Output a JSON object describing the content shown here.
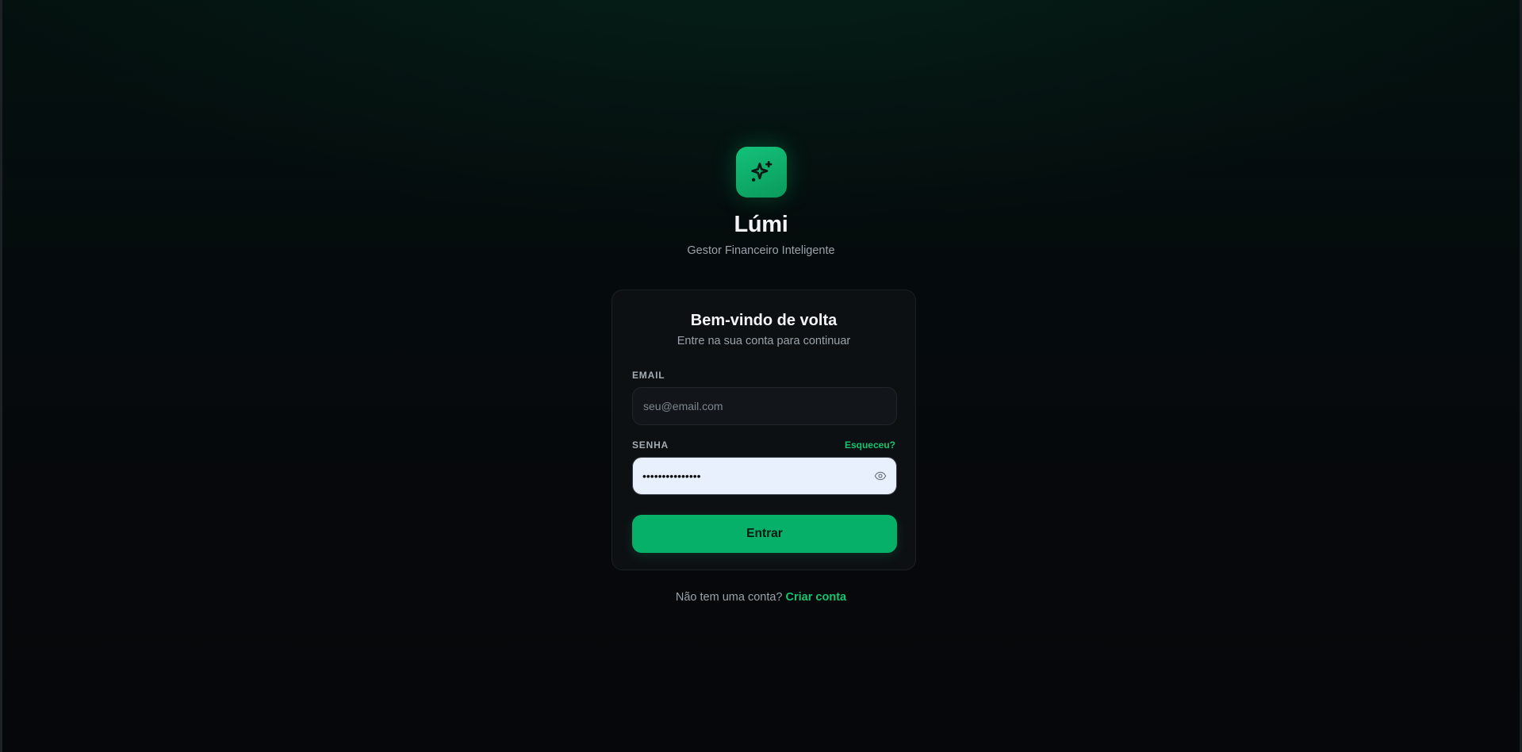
{
  "brand": {
    "icon": "sparkles-icon",
    "name": "Lúmi",
    "tagline": "Gestor Financeiro Inteligente"
  },
  "login_card": {
    "title": "Bem-vindo de volta",
    "subtitle": "Entre na sua conta para continuar",
    "email": {
      "label": "EMAIL",
      "placeholder": "seu@email.com",
      "value": ""
    },
    "password": {
      "label": "SENHA",
      "forgot_label": "Esqueceu?",
      "masked_value": "•••••••••••••••",
      "toggle_icon": "eye-icon"
    },
    "submit_label": "Entrar"
  },
  "signup": {
    "prompt": "Não tem uma conta?",
    "link_label": "Criar conta"
  },
  "colors": {
    "accent": "#06b068",
    "accent_text": "#16c46f",
    "card_bg": "#0d1013",
    "page_bg": "#06080a",
    "password_field_bg": "#e8f0fd"
  }
}
